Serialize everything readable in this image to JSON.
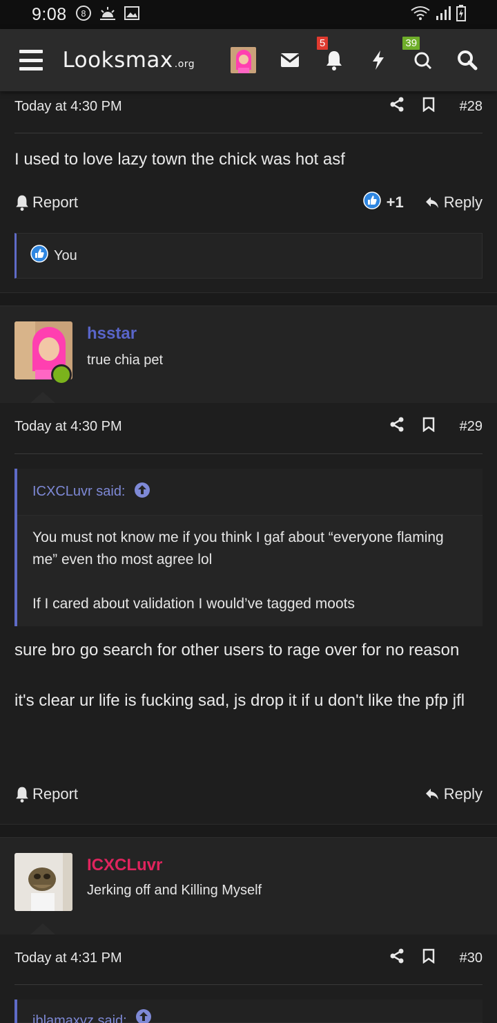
{
  "status_bar": {
    "time": "9:08"
  },
  "nav": {
    "logo_main": "Looksmax",
    "logo_tld": ".org",
    "alerts_badge": "5",
    "conversations_badge": "39"
  },
  "colors": {
    "accent": "#5f6bc7",
    "username_blue": "#5965c9",
    "username_red": "#e0245e",
    "online": "#7bb31c"
  },
  "post28": {
    "timestamp": "Today at 4:30 PM",
    "number": "#28",
    "text": "I used to love lazy town the chick was hot asf",
    "report_label": "Report",
    "reaction_count": "+1",
    "reply_label": "Reply",
    "liked_by": "You"
  },
  "post29": {
    "username": "hsstar",
    "user_title": "true chia pet",
    "timestamp": "Today at 4:30 PM",
    "number": "#29",
    "quote_author": "ICXCLuvr said:",
    "quote_para1": "You must not know me if you think I gaf about “everyone flaming me” even tho most agree lol",
    "quote_para2": "If I cared about validation I would’ve tagged moots",
    "text_para1": "sure bro go search for other users to rage over for no reason",
    "text_para2": "it's clear ur life is fucking sad, js drop it if u don't like the pfp jfl",
    "report_label": "Report",
    "reply_label": "Reply"
  },
  "post30": {
    "username": "ICXCLuvr",
    "user_title": "Jerking off and Killing Myself",
    "timestamp": "Today at 4:31 PM",
    "number": "#30",
    "quote_author": "jblamaxyz said:"
  }
}
